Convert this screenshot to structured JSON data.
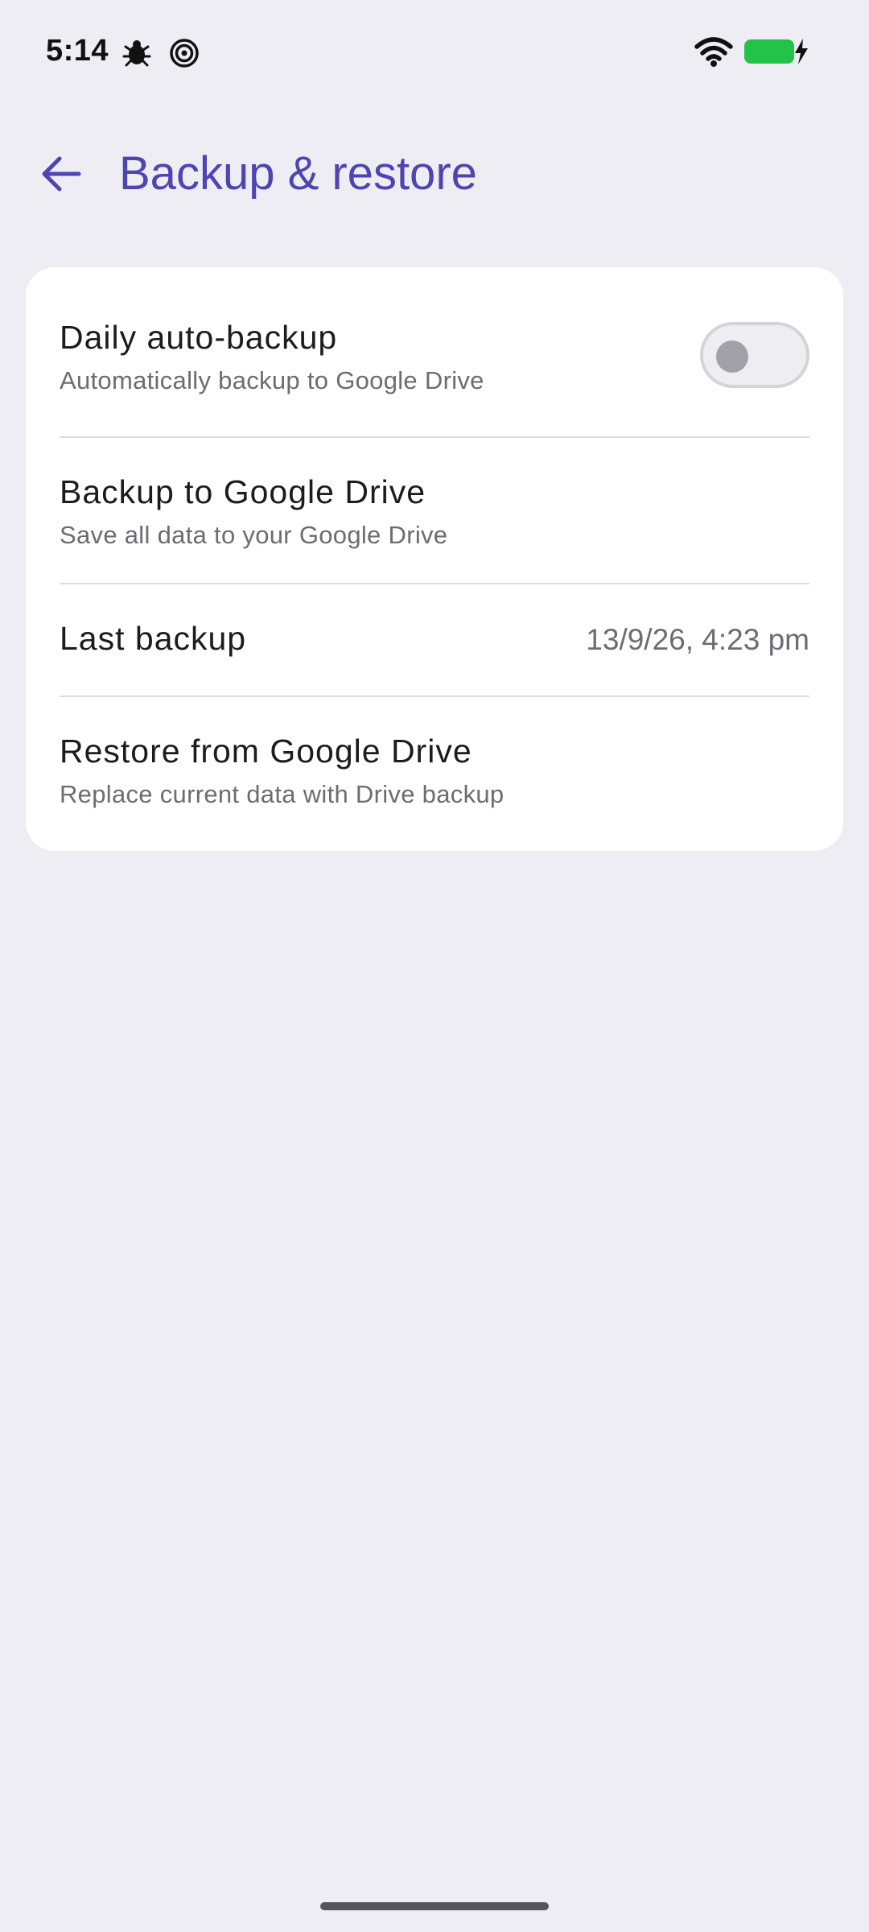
{
  "status_bar": {
    "time": "5:14",
    "left_icons": [
      "bug-icon",
      "spiral-icon"
    ],
    "right_icons": [
      "wifi-icon",
      "battery-charging-icon"
    ],
    "battery_color": "#22c348"
  },
  "app_bar": {
    "back_icon": "arrow-left-icon",
    "title": "Backup & restore",
    "accent_color": "#4e45b3"
  },
  "settings": {
    "daily_backup": {
      "title": "Daily auto-backup",
      "subtitle": "Automatically backup to Google Drive",
      "toggle_on": false
    },
    "backup_drive": {
      "title": "Backup to Google Drive",
      "subtitle": "Save all data to your Google Drive"
    },
    "last_backup": {
      "title": "Last backup",
      "value": "13/9/26, 4:23 pm"
    },
    "restore_drive": {
      "title": "Restore from Google Drive",
      "subtitle": "Replace current data with Drive backup"
    }
  }
}
